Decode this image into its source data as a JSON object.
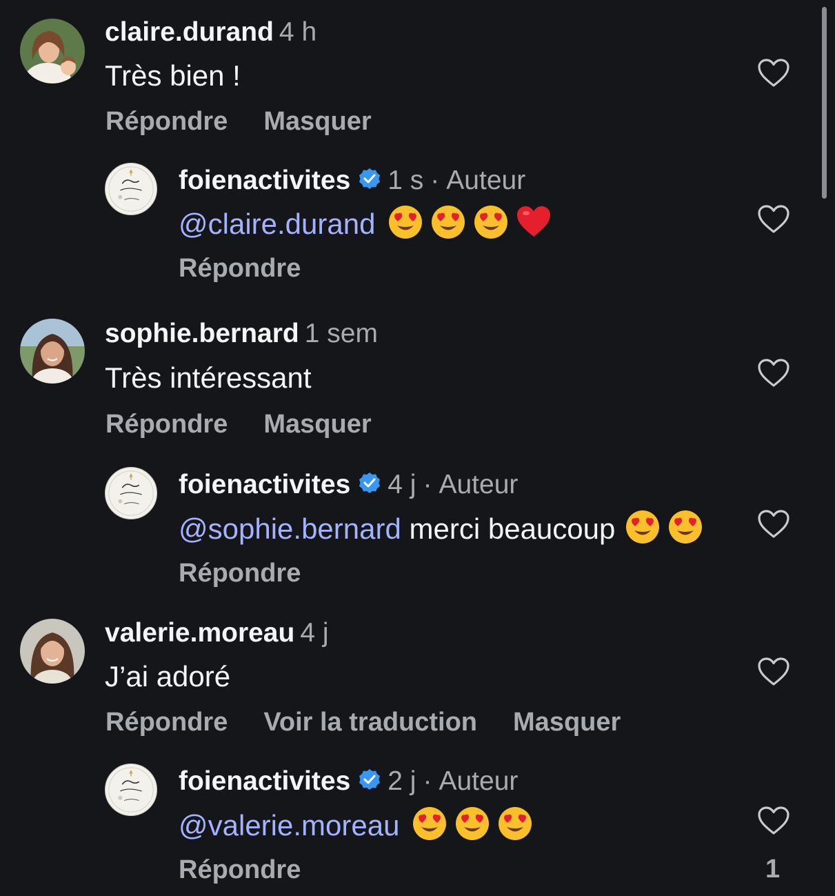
{
  "comments": [
    {
      "username": "claire.durand",
      "time": "4 h",
      "text": "Très bien !",
      "actions": [
        "Répondre",
        "Masquer"
      ],
      "avatar": "woman-with-child-avatar"
    },
    {
      "username": "foienactivites",
      "time": "1 s",
      "author_label": "Auteur",
      "mention": "@claire.durand",
      "text": "",
      "emojis": [
        "heart-eyes",
        "heart-eyes",
        "heart-eyes",
        "red-heart"
      ],
      "actions": [
        "Répondre"
      ],
      "avatar": "foi-logo-avatar"
    },
    {
      "username": "sophie.bernard",
      "time": "1 sem",
      "text": "Très intéressant",
      "actions": [
        "Répondre",
        "Masquer"
      ],
      "avatar": "woman-avatar"
    },
    {
      "username": "foienactivites",
      "time": "4 j",
      "author_label": "Auteur",
      "mention": "@sophie.bernard",
      "text": "merci beaucoup",
      "emojis": [
        "heart-eyes",
        "heart-eyes"
      ],
      "actions": [
        "Répondre"
      ],
      "avatar": "foi-logo-avatar"
    },
    {
      "username": "valerie.moreau",
      "time": "4 j",
      "text": "J’ai adoré",
      "actions": [
        "Répondre",
        "Voir la traduction",
        "Masquer"
      ],
      "avatar": "woman-avatar"
    },
    {
      "username": "foienactivites",
      "time": "2 j",
      "author_label": "Auteur",
      "mention": "@valerie.moreau",
      "text": "",
      "emojis": [
        "heart-eyes",
        "heart-eyes",
        "heart-eyes"
      ],
      "actions": [
        "Répondre"
      ],
      "avatar": "foi-logo-avatar",
      "like_count": "1"
    }
  ],
  "colors": {
    "background": "#14161a",
    "mention": "#a4b3ff",
    "secondary_text": "#a8abb0",
    "verified_badge": "#3897f0"
  }
}
